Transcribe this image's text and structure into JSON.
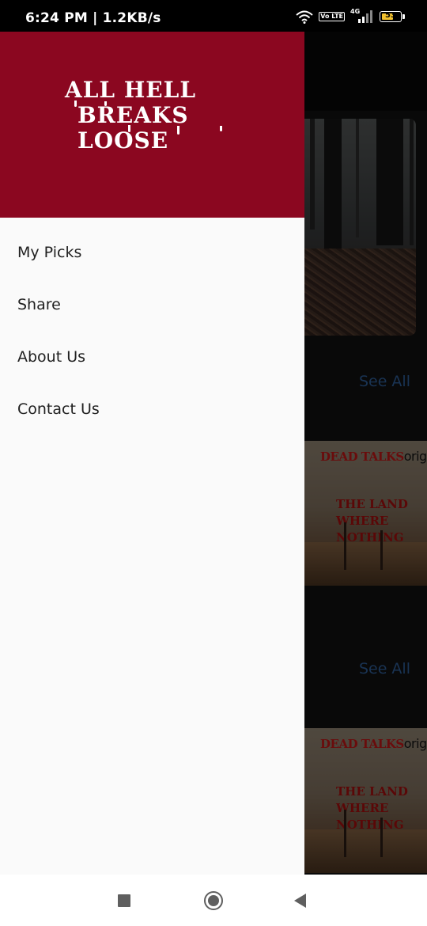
{
  "status_bar": {
    "time": "6:24 PM | 1.2KB/s",
    "volte": "Vo LTE",
    "network": "4G",
    "battery": "53",
    "icons": [
      "wifi-icon",
      "volte-icon",
      "signal-icon",
      "battery-icon"
    ]
  },
  "drawer": {
    "header_bg_color": "#8b0720",
    "logo_line1": "ALL HELL",
    "logo_line2": "BREAKS LOOSE",
    "menu_items": [
      {
        "label": "My Picks"
      },
      {
        "label": "Share"
      },
      {
        "label": "About Us"
      },
      {
        "label": "Contact Us"
      }
    ]
  },
  "background": {
    "see_all_1": "See All",
    "see_all_2": "See All",
    "poster_1": {
      "brand": "DEAD TALKS",
      "suffix": "origina",
      "title_line1": "THE LAND WHERE",
      "title_line2": "NOTHING GROWS"
    },
    "poster_2": {
      "brand": "DEAD TALKS",
      "suffix": "origina",
      "title_line1": "THE LAND WHERE",
      "title_line2": "NOTHING GROWS"
    },
    "link_color": "#274f80"
  },
  "navigation_bar": {
    "buttons": [
      "recents-button",
      "home-button",
      "back-button"
    ]
  }
}
